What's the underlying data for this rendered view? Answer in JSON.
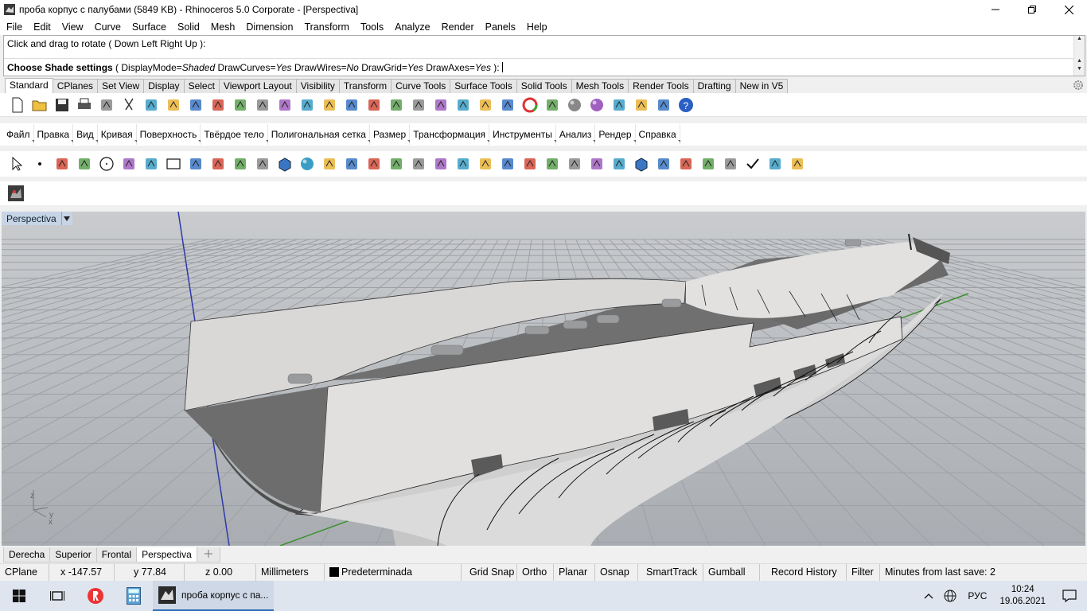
{
  "window": {
    "title": "проба корпус с палубами (5849 KB) - Rhinoceros  5.0 Corporate - [Perspectiva]",
    "controls": [
      "minimize",
      "restore",
      "close"
    ]
  },
  "menu": [
    "File",
    "Edit",
    "View",
    "Curve",
    "Surface",
    "Solid",
    "Mesh",
    "Dimension",
    "Transform",
    "Tools",
    "Analyze",
    "Render",
    "Panels",
    "Help"
  ],
  "command": {
    "history_line": "Click and drag to rotate ( Down  Left  Right  Up ):",
    "prompt_bold": "Choose Shade settings",
    "prompt_paren_open": " ( ",
    "opt1_name": "DisplayMode=",
    "opt1_val": "Shaded",
    "opt2_name": "  DrawCurves=",
    "opt2_val": "Yes",
    "opt3_name": "  DrawWires=",
    "opt3_val": "No",
    "opt4_name": "  DrawGrid=",
    "opt4_val": "Yes",
    "opt5_name": "  DrawAxes=",
    "opt5_val": "Yes",
    "prompt_close": " ): "
  },
  "toolbar_tabs": [
    "Standard",
    "CPlanes",
    "Set View",
    "Display",
    "Select",
    "Viewport Layout",
    "Visibility",
    "Transform",
    "Curve Tools",
    "Surface Tools",
    "Solid Tools",
    "Mesh Tools",
    "Render Tools",
    "Drafting",
    "New in V5"
  ],
  "active_tab": "Standard",
  "russian_menu": [
    "Файл",
    "Правка",
    "Вид",
    "Кривая",
    "Поверхность",
    "Твёрдое тело",
    "Полигональная сетка",
    "Размер",
    "Трансформация",
    "Инструменты",
    "Анализ",
    "Рендер",
    "Справка"
  ],
  "standard_icons": [
    "new-icon",
    "open-icon",
    "save-icon",
    "print-icon",
    "import-icon",
    "cut-icon",
    "copy-icon",
    "paste-icon",
    "undo-icon",
    "pan-icon",
    "rotate-view-icon",
    "zoom-dynamic-icon",
    "zoom-window-icon",
    "zoom-extents-icon",
    "zoom-selected-icon",
    "undo-view-icon",
    "four-viewports-icon",
    "car-icon",
    "select-filter-icon",
    "cplane-icon",
    "light-bulb-icon",
    "lock-icon",
    "layer-icon",
    "color-wheel-icon",
    "render-preview-icon",
    "rendered-sphere-icon",
    "shaded-sphere-icon",
    "properties-icon",
    "options-icon",
    "tree-icon",
    "help-icon"
  ],
  "modeling_icons": [
    "select-arrow-icon",
    "point-icon",
    "polyline-icon",
    "curve-icon",
    "circle-icon",
    "ellipse-icon",
    "polygon-icon",
    "rectangle-icon",
    "arc-icon",
    "fillet-curve-icon",
    "surface-corner-icon",
    "surface-edit-icon",
    "box-icon",
    "sphere-solid-icon",
    "cylinder-icon",
    "mesh-icon",
    "explode-icon",
    "split-icon",
    "trim-icon",
    "extend-icon",
    "boolean-icon",
    "point-cloud-icon",
    "curve-from-object-icon",
    "fillet-edge-icon",
    "text-icon",
    "dimension-icon",
    "group-icon",
    "block-icon",
    "box-edit-icon",
    "array-icon",
    "align-icon",
    "gumball-icon",
    "analyze-icon",
    "check-icon",
    "render-solid-icon",
    "drafting-icon"
  ],
  "viewport": {
    "name": "Perspectiva",
    "axis_labels": [
      "z",
      "y",
      "x"
    ]
  },
  "viewport_tabs": [
    "Derecha",
    "Superior",
    "Frontal",
    "Perspectiva"
  ],
  "active_viewport_tab": "Perspectiva",
  "status": {
    "cplane": "CPlane",
    "x": "x -147.57",
    "y": "y 77.84",
    "z": "z 0.00",
    "units": "Millimeters",
    "layer": "Predeterminada",
    "grid_snap": "Grid Snap",
    "ortho": "Ortho",
    "planar": "Planar",
    "osnap": "Osnap",
    "smarttrack": "SmartTrack",
    "gumball": "Gumball",
    "record_history": "Record History",
    "filter": "Filter",
    "save_info": "Minutes from last save: 2"
  },
  "taskbar": {
    "active_task": "проба корпус с па...",
    "lang": "РУС",
    "time": "10:24",
    "date": "19.06.2021"
  }
}
